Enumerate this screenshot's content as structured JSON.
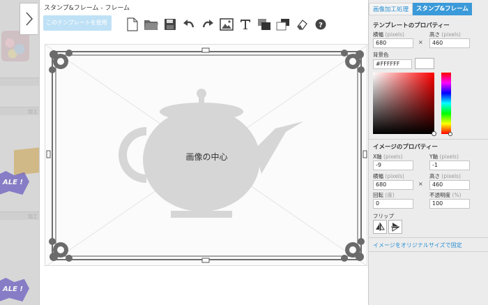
{
  "background": {
    "strip_label": "加工",
    "sale_text": "ALE !"
  },
  "editor": {
    "title": "スタンプ&フレーム  -  フレーム",
    "use_template_button": "このテンプレートを使用",
    "toolbar": [
      {
        "name": "new-document-icon"
      },
      {
        "name": "open-folder-icon"
      },
      {
        "name": "save-disk-icon"
      },
      {
        "name": "undo-icon"
      },
      {
        "name": "redo-icon"
      },
      {
        "name": "image-icon"
      },
      {
        "name": "text-icon"
      },
      {
        "name": "bring-forward-icon"
      },
      {
        "name": "send-backward-icon"
      },
      {
        "name": "eraser-icon"
      },
      {
        "name": "help-icon"
      }
    ],
    "canvas_center_label": "画像の中心"
  },
  "right_panel": {
    "tabs": [
      {
        "label": "画像加工処理",
        "active": false
      },
      {
        "label": "スタンプ&フレーム",
        "active": true
      }
    ],
    "template_props": {
      "title": "テンプレートのプロパティー",
      "width_label": "横幅",
      "height_label": "高さ",
      "unit_pixels": "(pixels)",
      "width_value": "680",
      "height_value": "460",
      "times": "×",
      "bg_color_label": "背景色",
      "bg_color_value": "#FFFFFF"
    },
    "image_props": {
      "title": "イメージのプロパティー",
      "x_label": "X軸",
      "y_label": "Y軸",
      "unit_pixels": "(pixels)",
      "x_value": "-9",
      "y_value": "-1",
      "width_label": "横幅",
      "height_label": "高さ",
      "width_value": "680",
      "height_value": "460",
      "times": "×",
      "rotation_label": "回転",
      "rotation_unit": "(度)",
      "rotation_value": "0",
      "opacity_label": "不透明度",
      "opacity_unit": "(%)",
      "opacity_value": "100",
      "flip_label": "フリップ",
      "restore_link": "イメージをオリジナルサイズで固定"
    }
  },
  "colors": {
    "accent": "#3b9ad9",
    "link": "#2a8fd0",
    "button_disabled": "#bfe1f6",
    "frame": "#6e6e6e",
    "watermark": "#d6d6d6"
  }
}
